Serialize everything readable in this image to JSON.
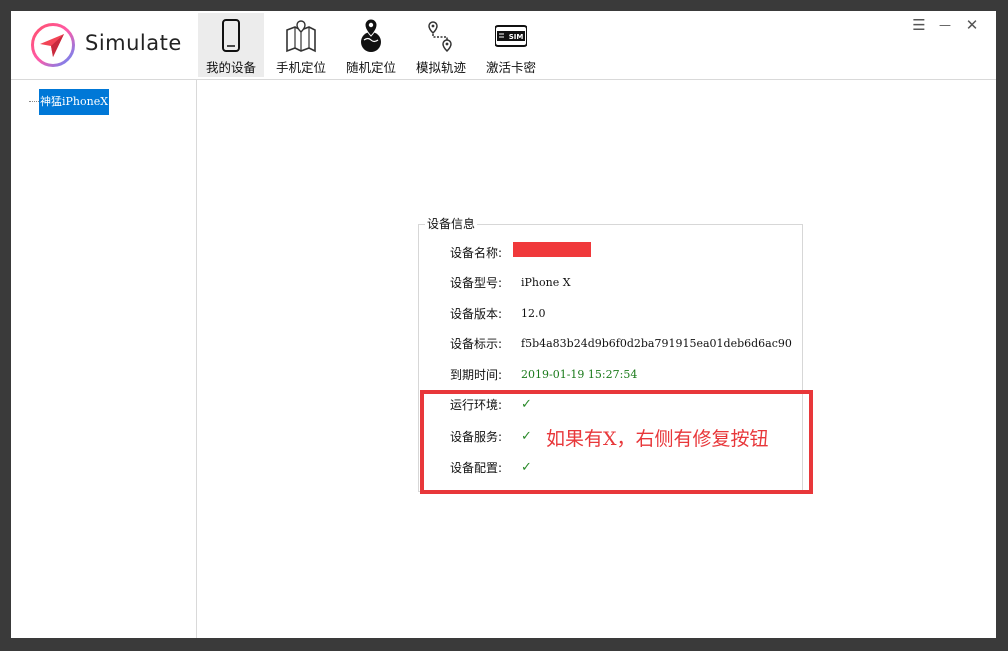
{
  "app": {
    "name": "Simulate"
  },
  "toolbar": {
    "tabs": [
      {
        "label": "我的设备",
        "icon": "phone-icon"
      },
      {
        "label": "手机定位",
        "icon": "map-icon"
      },
      {
        "label": "随机定位",
        "icon": "globe-pin-icon"
      },
      {
        "label": "模拟轨迹",
        "icon": "route-icon"
      },
      {
        "label": "激活卡密",
        "icon": "sim-card-icon"
      }
    ],
    "sim_icon_text": "SIM",
    "active_tab": "我的设备"
  },
  "window_controls": {
    "menu": "☰",
    "minimize": "—",
    "close": "✕"
  },
  "sidebar": {
    "devices": [
      {
        "label": "神猛iPhoneX",
        "selected": true
      }
    ]
  },
  "device_info": {
    "title": "设备信息",
    "rows": [
      {
        "key": "设备名称:",
        "value": ""
      },
      {
        "key": "设备型号:",
        "value": "iPhone X"
      },
      {
        "key": "设备版本:",
        "value": "12.0"
      },
      {
        "key": "设备标示:",
        "value": "f5b4a83b24d9b6f0d2ba791915ea01deb6d6ac90"
      },
      {
        "key": "到期时间:",
        "value": "2019-01-19 15:27:54"
      },
      {
        "key": "运行环境:",
        "value": "✓"
      },
      {
        "key": "设备服务:",
        "value": "✓"
      },
      {
        "key": "设备配置:",
        "value": "✓"
      }
    ]
  },
  "annotation": {
    "text": "如果有X，右侧有修复按钮",
    "color": "#e8373a"
  },
  "colors": {
    "selection": "#0078d7",
    "expiry_text": "#1a7a1a",
    "check": "#2a8a2a",
    "redaction": "#f0393b"
  }
}
